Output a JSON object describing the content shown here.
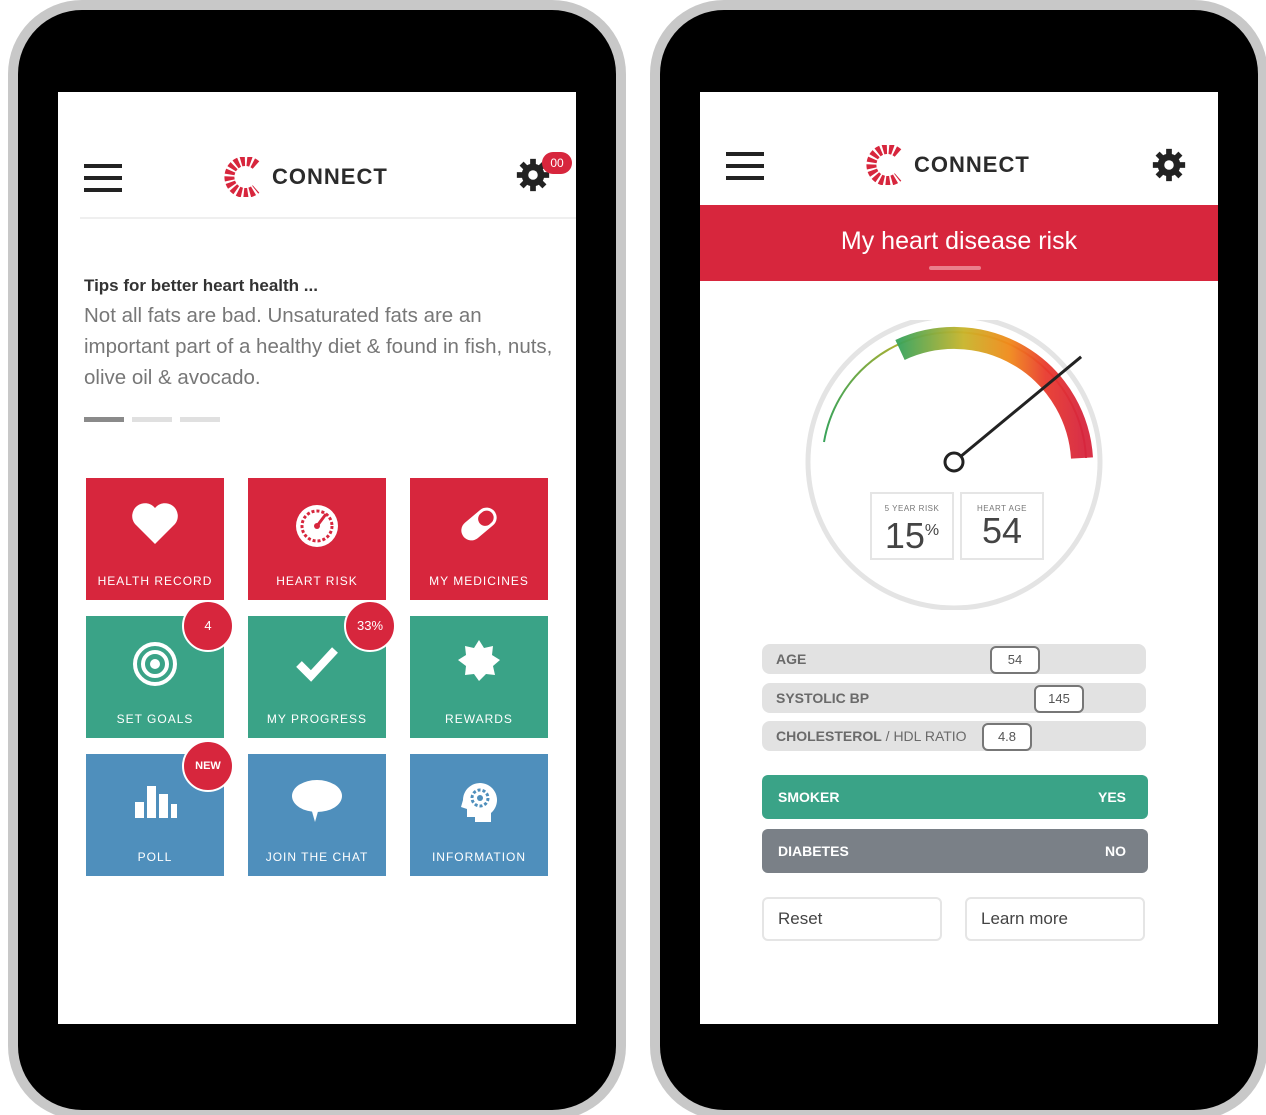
{
  "left_phone": {
    "header": {
      "app_name": "CONNECT",
      "notification_count": "00"
    },
    "tips": {
      "title": "Tips for better heart health ...",
      "body": "Not all fats are bad. Unsaturated fats are an important part of a healthy diet & found in fish, nuts, olive oil & avocado.",
      "page_indicator": {
        "count": 3,
        "active": 1
      }
    },
    "tiles": [
      {
        "label": "HEALTH RECORD",
        "icon": "heart-icon"
      },
      {
        "label": "HEART RISK",
        "icon": "speedometer-icon"
      },
      {
        "label": "MY MEDICINES",
        "icon": "pill-icon"
      },
      {
        "label": "SET GOALS",
        "icon": "target-icon",
        "badge": "4"
      },
      {
        "label": "MY PROGRESS",
        "icon": "checkmark-icon",
        "badge": "33%"
      },
      {
        "label": "REWARDS",
        "icon": "rosette-icon"
      },
      {
        "label": "POLL",
        "icon": "bar-chart-icon",
        "badge": "NEW"
      },
      {
        "label": "JOIN THE CHAT",
        "icon": "speech-bubble-icon"
      },
      {
        "label": "INFORMATION",
        "icon": "head-gear-icon"
      }
    ],
    "colors": {
      "red": "#d7263d",
      "green": "#3aa387",
      "blue": "#4f8fbc"
    }
  },
  "right_phone": {
    "header": {
      "app_name": "CONNECT"
    },
    "banner_title": "My heart disease risk",
    "gauge": {
      "five_year_risk_label": "5 YEAR RISK",
      "five_year_risk_value": "15",
      "five_year_risk_unit": "%",
      "heart_age_label": "HEART AGE",
      "heart_age_value": "54",
      "needle_fraction": 0.78
    },
    "factors": [
      {
        "label": "AGE",
        "value": "54"
      },
      {
        "label": "SYSTOLIC BP",
        "value": "145"
      },
      {
        "label": "CHOLESTEROL",
        "label_suffix": " / HDL RATIO",
        "value": "4.8"
      }
    ],
    "toggles": [
      {
        "label": "SMOKER",
        "value": "YES"
      },
      {
        "label": "DIABETES",
        "value": "NO"
      }
    ],
    "buttons": {
      "reset": "Reset",
      "learn_more": "Learn more"
    }
  }
}
